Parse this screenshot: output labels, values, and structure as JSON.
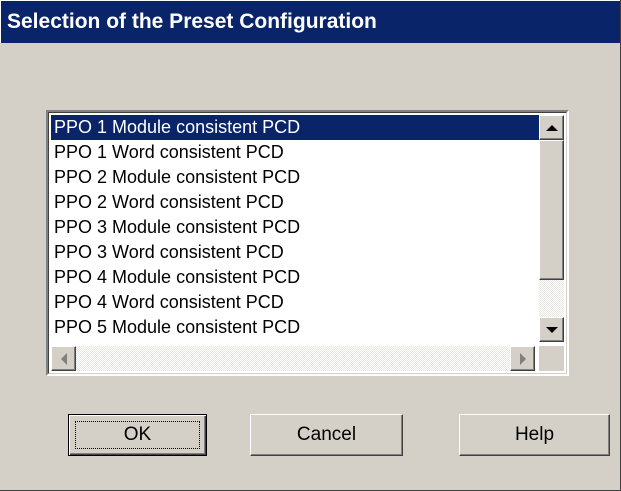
{
  "dialog": {
    "title": "Selection of the Preset Configuration"
  },
  "config_list": {
    "items": [
      "PPO 1 Module consistent PCD",
      "PPO 1 Word consistent PCD",
      "PPO 2 Module consistent PCD",
      "PPO 2 Word consistent PCD",
      "PPO 3 Module consistent PCD",
      "PPO 3 Word consistent PCD",
      "PPO 4 Module consistent PCD",
      "PPO 4 Word consistent PCD",
      "PPO 5 Module consistent PCD"
    ],
    "selected_index": 0,
    "vertical_scroll_position": 0.4
  },
  "buttons": {
    "ok_label": "OK",
    "cancel_label": "Cancel",
    "help_label": "Help"
  },
  "colors": {
    "title_bar": "#0a246a",
    "selection": "#0a246a",
    "dialog_face": "#d4d0c8"
  }
}
